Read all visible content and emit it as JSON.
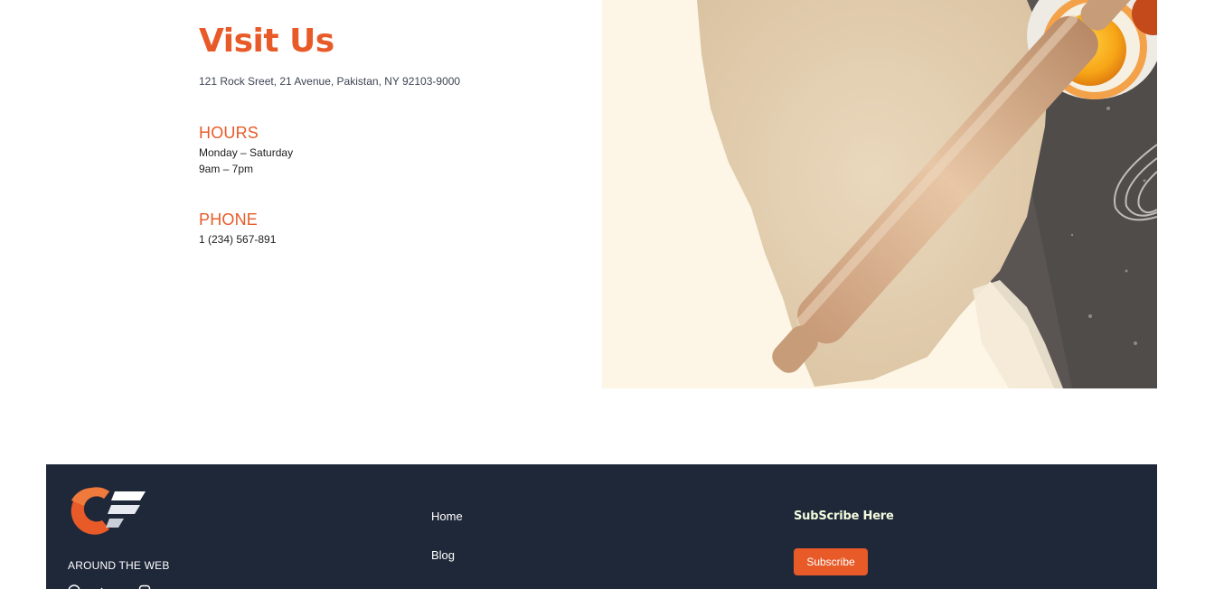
{
  "visit": {
    "title": "Visit Us",
    "address": "121 Rock Sreet, 21 Avenue, Pakistan, NY 92103-9000",
    "hours": {
      "heading": "HOURS",
      "days": "Monday – Saturday",
      "time": "9am – 7pm"
    },
    "phone": {
      "heading": "PHONE",
      "number": "1 (234) 567-891"
    }
  },
  "footer": {
    "around_label": "AROUND THE WEB",
    "social_icons": [
      "facebook-icon",
      "twitter-icon",
      "linkedin-icon",
      "instagram-icon"
    ],
    "nav": [
      {
        "label": "Home"
      },
      {
        "label": "Blog"
      }
    ],
    "subscribe": {
      "title": "SubScribe Here",
      "button": "Subscribe"
    }
  },
  "colors": {
    "accent": "#e85b29",
    "footer_bg": "#1f2839",
    "hero_bg": "#fdf6e6",
    "subscribe_title": "#f3fadd"
  }
}
